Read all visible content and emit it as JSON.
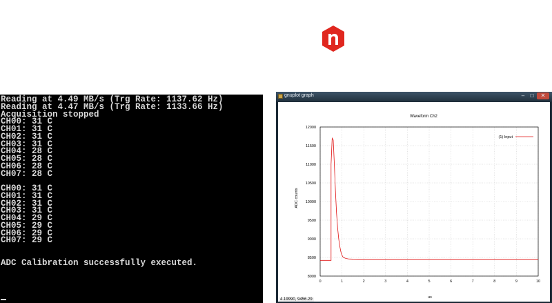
{
  "logo": {
    "color": "#e0271f",
    "icon": "n-logo"
  },
  "console": {
    "lines": [
      "Reading at 4.49 MB/s (Trg Rate: 1137.62 Hz)",
      "Reading at 4.47 MB/s (Trg Rate: 1133.66 Hz)",
      "Acquisition stopped",
      "CH00: 31 C",
      "CH01: 31 C",
      "CH02: 31 C",
      "CH03: 31 C",
      "CH04: 28 C",
      "CH05: 28 C",
      "CH06: 28 C",
      "CH07: 28 C",
      "",
      "CH00: 31 C",
      "CH01: 31 C",
      "CH02: 31 C",
      "CH03: 31 C",
      "CH04: 29 C",
      "CH05: 29 C",
      "CH06: 29 C",
      "CH07: 29 C",
      "",
      "",
      "ADC Calibration successfully executed."
    ]
  },
  "gnuplot": {
    "window_title": "gnuplot graph",
    "status_text": "4.19990, 9456.29",
    "chart_data": {
      "type": "line",
      "title": "Waveform Ch2",
      "xlabel": "us",
      "ylabel": "ADC counts",
      "xlim": [
        0,
        10
      ],
      "ylim": [
        8000,
        12000
      ],
      "x_ticks": [
        "0",
        "1",
        "2",
        "3",
        "4",
        "5",
        "6",
        "7",
        "8",
        "9",
        "10"
      ],
      "y_ticks": [
        "8000",
        "8500",
        "9000",
        "9500",
        "10000",
        "10500",
        "11000",
        "11500",
        "12000"
      ],
      "grid": true,
      "legend_position": "top-right",
      "series": [
        {
          "name": "(1) Input",
          "color": "#e01010",
          "x": [
            0,
            0.5,
            0.5,
            0.55,
            0.6,
            0.62,
            0.65,
            0.7,
            0.75,
            0.8,
            0.85,
            0.9,
            0.95,
            1.0,
            1.05,
            1.1,
            1.2,
            1.3,
            1.5,
            2,
            3,
            4,
            5,
            6,
            7,
            8,
            9,
            10
          ],
          "y": [
            8420,
            8420,
            11000,
            11700,
            11650,
            11400,
            11000,
            10300,
            9700,
            9300,
            9000,
            8800,
            8650,
            8560,
            8510,
            8490,
            8470,
            8460,
            8455,
            8450,
            8450,
            8450,
            8450,
            8450,
            8450,
            8450,
            8450,
            8450
          ]
        }
      ]
    }
  }
}
